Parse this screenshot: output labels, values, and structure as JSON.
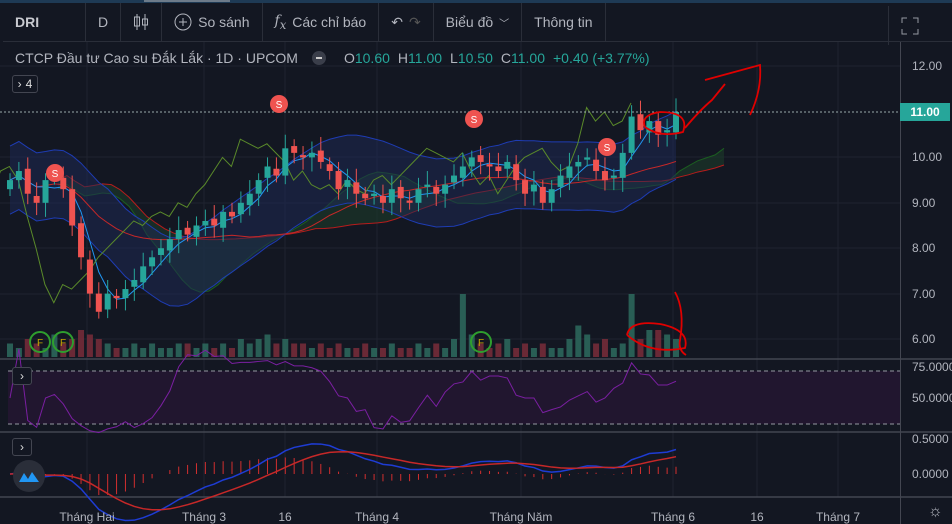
{
  "toolbar": {
    "symbol": "DRI",
    "interval": "D",
    "compare": "So sánh",
    "indicators": "Các chỉ báo",
    "chart_menu": "Biểu đồ",
    "info": "Thông tin"
  },
  "legend": {
    "title": "CTCP Đầu tư Cao su Đắk Lắk · 1D · UPCOM",
    "o_label": "O",
    "o": "10.60",
    "h_label": "H",
    "h": "11.00",
    "l_label": "L",
    "l": "10.50",
    "c_label": "C",
    "c": "11.00",
    "change": "+0.40 (+3.77%)"
  },
  "collapsed_count": "4",
  "price_axis": {
    "labels": [
      "12.00",
      "10.00",
      "9.00",
      "8.00",
      "7.00",
      "6.00"
    ],
    "current": "11.00"
  },
  "rsi_axis": [
    "75.0000",
    "50.0000"
  ],
  "macd_axis": [
    "0.5000",
    "0.0000"
  ],
  "time_axis": [
    "Tháng Hai",
    "Tháng 3",
    "16",
    "Tháng 4",
    "Tháng Năm",
    "Tháng 6",
    "16",
    "Tháng 7"
  ],
  "signals": {
    "sell": "S",
    "buy": "F"
  },
  "colors": {
    "up": "#26a69a",
    "down": "#ef5350",
    "bg": "#131722",
    "annotation": "#e00000"
  },
  "chart_data": {
    "type": "candlestick",
    "closes": [
      9.5,
      9.7,
      9.2,
      9.0,
      9.5,
      9.6,
      9.3,
      8.5,
      7.8,
      7.0,
      6.6,
      7.0,
      6.9,
      7.1,
      7.3,
      7.6,
      7.8,
      8.0,
      8.2,
      8.4,
      8.3,
      8.5,
      8.6,
      8.5,
      8.8,
      8.7,
      9.0,
      9.2,
      9.5,
      9.8,
      9.6,
      10.2,
      10.1,
      10.0,
      10.1,
      9.9,
      9.7,
      9.3,
      9.5,
      9.2,
      9.1,
      9.2,
      9.0,
      9.3,
      9.1,
      9.0,
      9.3,
      9.4,
      9.2,
      9.4,
      9.6,
      9.8,
      10.0,
      9.9,
      9.8,
      9.7,
      9.9,
      9.5,
      9.2,
      9.4,
      9.0,
      9.3,
      9.6,
      9.8,
      9.9,
      10.0,
      9.7,
      9.5,
      9.6,
      10.1,
      10.9,
      10.6,
      10.8,
      10.5,
      10.6,
      11.0
    ],
    "volumes": [
      3,
      2,
      4,
      3,
      2,
      5,
      3,
      4,
      6,
      5,
      4,
      3,
      2,
      2,
      3,
      2,
      3,
      2,
      2,
      3,
      3,
      2,
      3,
      2,
      3,
      2,
      4,
      3,
      4,
      5,
      3,
      4,
      3,
      3,
      2,
      3,
      2,
      3,
      2,
      2,
      3,
      2,
      2,
      3,
      2,
      2,
      3,
      2,
      3,
      2,
      4,
      14,
      5,
      3,
      2,
      3,
      4,
      2,
      3,
      2,
      3,
      2,
      2,
      4,
      7,
      5,
      3,
      4,
      2,
      3,
      14,
      4,
      6,
      6,
      5,
      4
    ]
  }
}
